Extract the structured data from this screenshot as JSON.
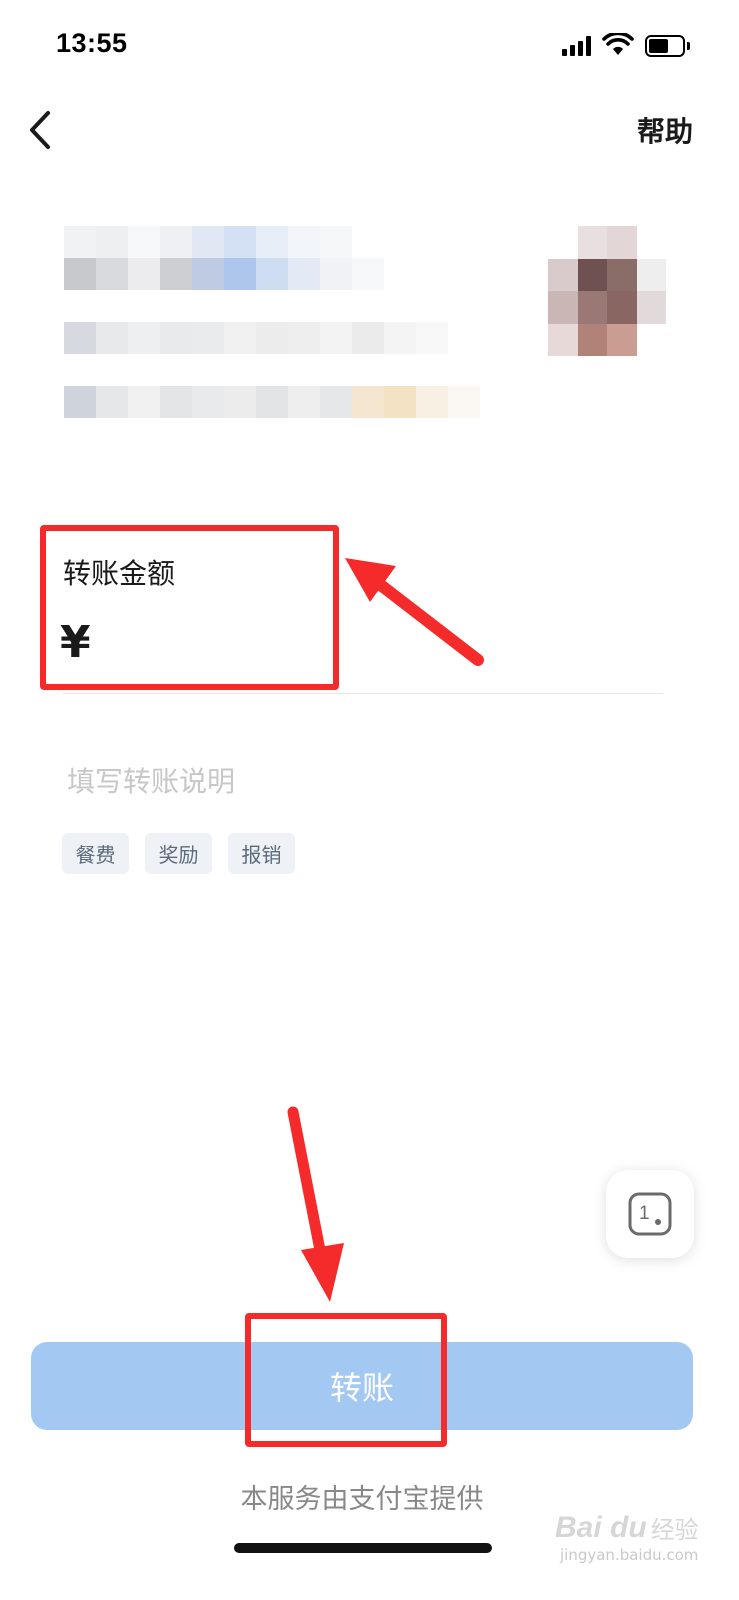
{
  "status_bar": {
    "time": "13:55"
  },
  "nav": {
    "help_label": "帮助"
  },
  "amount": {
    "label": "转账金额",
    "currency_symbol": "¥"
  },
  "note": {
    "placeholder": "填写转账说明"
  },
  "tags": [
    "餐费",
    "奖励",
    "报销"
  ],
  "floating_button": {
    "label": "1"
  },
  "primary_button": {
    "label": "转账"
  },
  "footer": {
    "note": "本服务由支付宝提供"
  },
  "watermark": {
    "logo": "Bai du",
    "text": "经验",
    "url": "jingyan.baidu.com"
  },
  "colors": {
    "accent_button": "#a3c9f2",
    "annotation": "#f52b2b",
    "tag_bg": "#eef2f6"
  }
}
